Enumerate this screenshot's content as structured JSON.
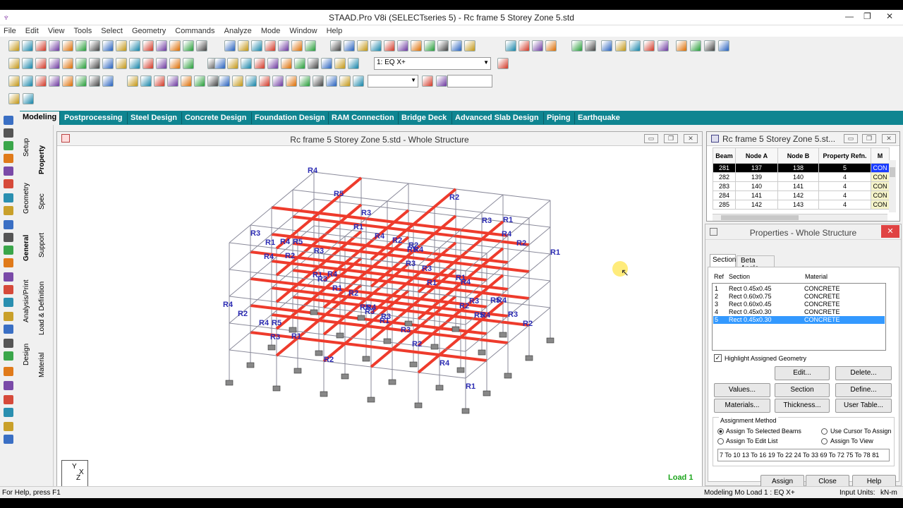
{
  "window": {
    "title": "STAAD.Pro V8i (SELECTseries 5) - Rc frame 5 Storey Zone 5.std",
    "minimize": "—",
    "maximize": "❐",
    "close": "✕"
  },
  "menu": [
    "File",
    "Edit",
    "View",
    "Tools",
    "Select",
    "Geometry",
    "Commands",
    "Analyze",
    "Mode",
    "Window",
    "Help"
  ],
  "toolbar": {
    "load_case": "1: EQ X+"
  },
  "page_tabs": [
    "Modeling",
    "Postprocessing",
    "Steel Design",
    "Concrete Design",
    "Foundation Design",
    "RAM Connection",
    "Bridge Deck",
    "Advanced Slab Design",
    "Piping",
    "Earthquake"
  ],
  "left_tabs": {
    "outer": [
      "Setup",
      "Geometry",
      "General",
      "Analysis/Print",
      "Design"
    ],
    "inner": [
      "Property",
      "Spec",
      "Support",
      "Load & Definition",
      "Material"
    ]
  },
  "viewport": {
    "title": "Rc frame 5 Storey Zone 5.std - Whole Structure",
    "load_label": "Load 1",
    "axis": {
      "y": "Y",
      "x": "X",
      "z": "Z"
    }
  },
  "member_labels": [
    "R4",
    "R4",
    "R4",
    "R4",
    "R4",
    "R4",
    "R4",
    "R4",
    "R4",
    "R4",
    "R4",
    "R4",
    "R4",
    "R4",
    "R3",
    "R3",
    "R3",
    "R3",
    "R3",
    "R3",
    "R3",
    "R3",
    "R3",
    "R3",
    "R3",
    "R3",
    "R3",
    "R2",
    "R2",
    "R2",
    "R2",
    "R2",
    "R2",
    "R2",
    "R2",
    "R2",
    "R2",
    "R2",
    "R1",
    "R1",
    "R1",
    "R1",
    "R1",
    "R1",
    "R1",
    "R1",
    "R1",
    "R1",
    "R1",
    "R5",
    "R5",
    "R5",
    "R5",
    "R5",
    "R5",
    "R5"
  ],
  "beam_table": {
    "title": "Rc frame 5 Storey Zone 5.st...",
    "headers": [
      "Beam",
      "Node A",
      "Node B",
      "Property Refn.",
      "M"
    ],
    "rows": [
      [
        "281",
        "137",
        "138",
        "5",
        "CON"
      ],
      [
        "282",
        "139",
        "140",
        "4",
        "CON"
      ],
      [
        "283",
        "140",
        "141",
        "4",
        "CON"
      ],
      [
        "284",
        "141",
        "142",
        "4",
        "CON"
      ],
      [
        "285",
        "142",
        "143",
        "4",
        "CON"
      ]
    ]
  },
  "properties": {
    "title": "Properties - Whole Structure",
    "tabs": [
      "Section",
      "Beta Angle"
    ],
    "headers": [
      "Ref",
      "Section",
      "Material"
    ],
    "sections": [
      {
        "ref": "1",
        "section": "Rect 0.45x0.45",
        "material": "CONCRETE"
      },
      {
        "ref": "2",
        "section": "Rect 0.60x0.75",
        "material": "CONCRETE"
      },
      {
        "ref": "3",
        "section": "Rect 0.60x0.45",
        "material": "CONCRETE"
      },
      {
        "ref": "4",
        "section": "Rect 0.45x0.30",
        "material": "CONCRETE"
      },
      {
        "ref": "5",
        "section": "Rect 0.45x0.30",
        "material": "CONCRETE"
      }
    ],
    "highlight_label": "Highlight Assigned Geometry",
    "buttons": {
      "edit": "Edit...",
      "delete": "Delete...",
      "values": "Values...",
      "section_db": "Section Database",
      "define": "Define...",
      "materials": "Materials...",
      "thickness": "Thickness...",
      "user_table": "User Table..."
    },
    "assignment": {
      "legend": "Assignment Method",
      "opt1": "Assign To Selected Beams",
      "opt2": "Use Cursor To Assign",
      "opt3": "Assign To Edit List",
      "opt4": "Assign To View",
      "edit_list": "7 To 10 13 To 16 19 To 22 24 To 33 69 To 72 75 To 78 81"
    },
    "footer": {
      "assign": "Assign",
      "close": "Close",
      "help": "Help"
    }
  },
  "status": {
    "help": "For Help, press F1",
    "mode": "Modeling Mo Load 1 : EQ X+",
    "units_label": "Input Units:",
    "units": "kN-m"
  },
  "colors": {
    "tab_bar": "#0f8591",
    "beam": "#ee3b2c",
    "label": "#2b2bb3",
    "selection": "#1e90ff"
  }
}
